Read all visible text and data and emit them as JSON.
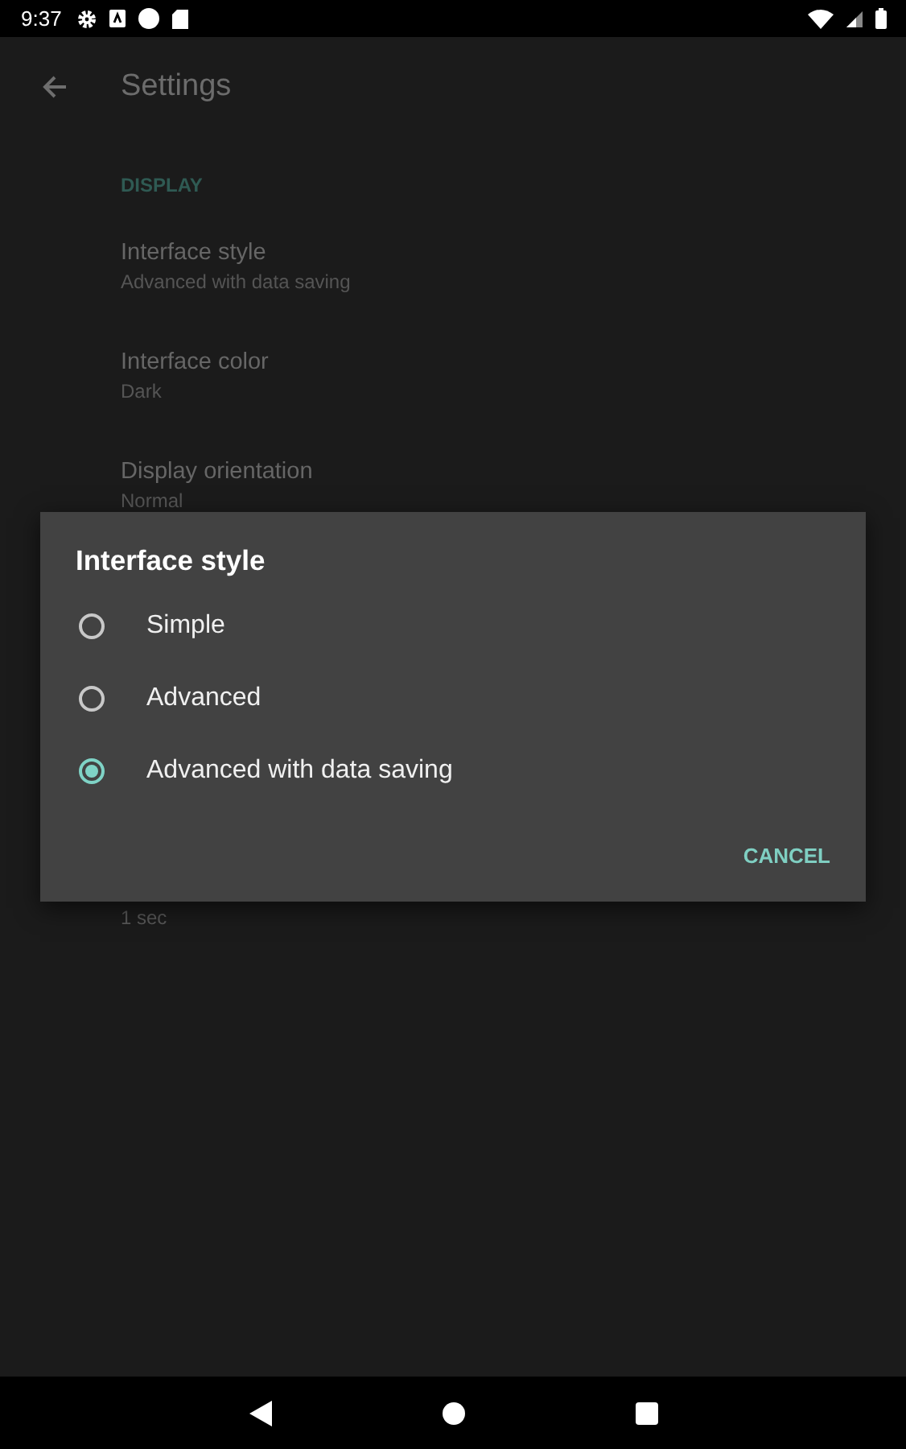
{
  "status_bar": {
    "time": "9:37"
  },
  "app_bar": {
    "title": "Settings"
  },
  "section": {
    "header": "DISPLAY"
  },
  "settings": [
    {
      "title": "Interface style",
      "summary": "Advanced with data saving"
    },
    {
      "title": "Interface color",
      "summary": "Dark"
    },
    {
      "title": "Display orientation",
      "summary": "Normal"
    }
  ],
  "peek_summary": "1 sec",
  "dialog": {
    "title": "Interface style",
    "options": [
      {
        "label": "Simple",
        "selected": false
      },
      {
        "label": "Advanced",
        "selected": false
      },
      {
        "label": "Advanced with data saving",
        "selected": true
      }
    ],
    "button": "CANCEL"
  }
}
